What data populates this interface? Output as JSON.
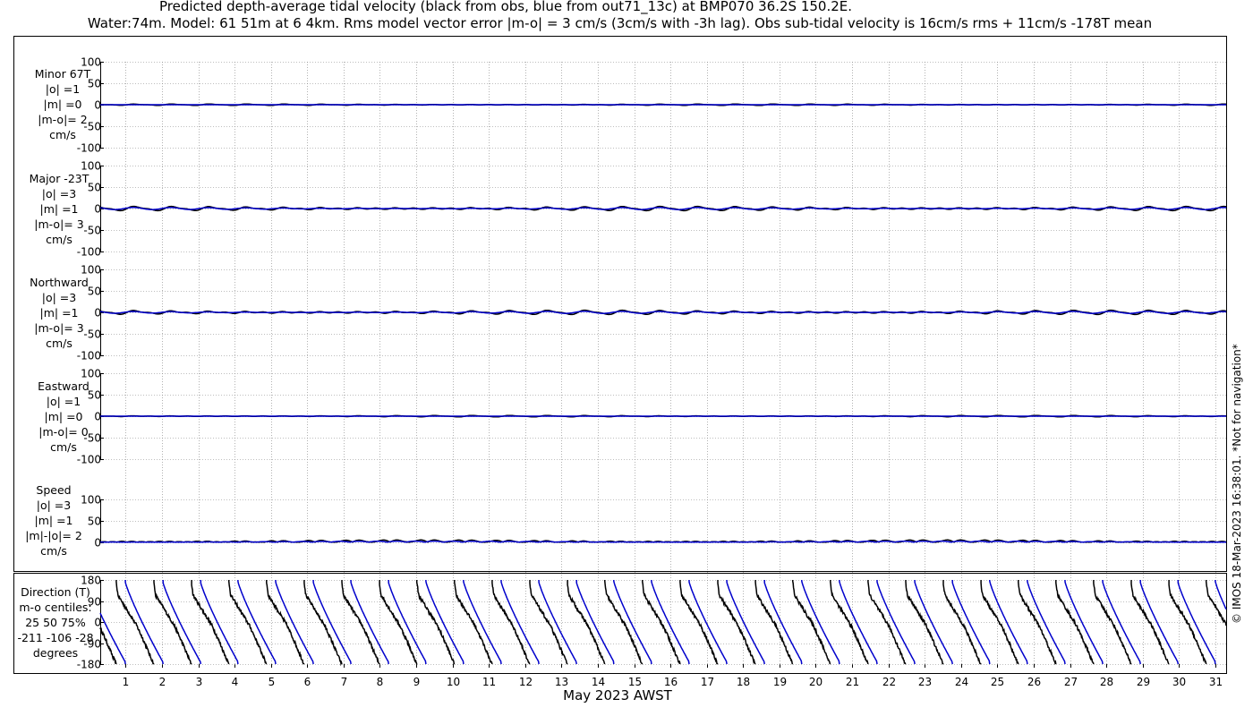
{
  "title_line1": "Predicted depth-average tidal velocity (black from obs, blue from out71_13c) at BMP070 36.2S 150.2E.",
  "title_line2": "Water:74m. Model: 61 51m at 6 4km. Rms model vector error |m-o| = 3 cm/s (3cm/s with -3h lag). Obs sub-tidal velocity is 16cm/s rms + 11cm/s -178T mean",
  "copyright": "© IMOS 18-Mar-2023 16:38:01. *Not for navigation*",
  "colors": {
    "obs": "#000000",
    "model": "#0000cc",
    "grid": "#7f7f7f"
  },
  "panels": [
    {
      "lines": [
        "Minor 67T",
        "|o| =1",
        "|m| =0",
        "|m-o|= 2",
        "cm/s"
      ]
    },
    {
      "lines": [
        "Major -23T",
        "|o| =3",
        "|m| =1",
        "|m-o|= 3",
        "cm/s"
      ]
    },
    {
      "lines": [
        "Northward",
        "|o| =3",
        "|m| =1",
        "|m-o|= 3",
        "cm/s"
      ]
    },
    {
      "lines": [
        "Eastward",
        "|o| =1",
        "|m| =0",
        "|m-o|= 0",
        "cm/s"
      ]
    },
    {
      "lines": [
        "Speed",
        "|o| =3",
        "|m| =1",
        "|m|-|o|= 2",
        "cm/s"
      ]
    },
    {
      "lines": [
        "Direction (T)",
        "m-o centiles:",
        "25  50  75%",
        "-211 -106  -28",
        "degrees"
      ]
    }
  ],
  "chart_data": {
    "type": "line",
    "title": "Predicted depth-average tidal velocity (black from obs, blue from out71_13c) at BMP070 36.2S 150.2E.",
    "xlabel": "May 2023 AWST",
    "x_ticks": [
      "1",
      "2",
      "3",
      "4",
      "5",
      "6",
      "7",
      "8",
      "9",
      "10",
      "11",
      "12",
      "13",
      "14",
      "15",
      "16",
      "17",
      "18",
      "19",
      "20",
      "21",
      "22",
      "23",
      "24",
      "25",
      "26",
      "27",
      "28",
      "29",
      "30",
      "31"
    ],
    "xlim_days": [
      0.3,
      31.3
    ],
    "velocity_yticks": [
      "100",
      "50",
      "0",
      "-50",
      "-100"
    ],
    "velocity_ylim": [
      -100,
      100
    ],
    "direction_yticks": [
      "180",
      "90",
      "0",
      "-90",
      "-180"
    ],
    "direction_ylim": [
      -180,
      180
    ],
    "series": [
      {
        "name": "obs",
        "color": "#000000"
      },
      {
        "name": "out71_13c",
        "color": "#0000cc"
      }
    ],
    "amplitudes_cm_s": {
      "minor": {
        "obs": 1,
        "model": 0
      },
      "major": {
        "obs": 3,
        "model": 1
      },
      "northward": {
        "obs": 3,
        "model": 1
      },
      "eastward": {
        "obs": 1,
        "model": 0
      },
      "speed": {
        "obs": 3,
        "model": 1
      }
    },
    "direction_centiles_deg": {
      "p25": -211,
      "p50": -106,
      "p75": -28
    },
    "tidal_period_days": 1.035,
    "grid": true
  }
}
